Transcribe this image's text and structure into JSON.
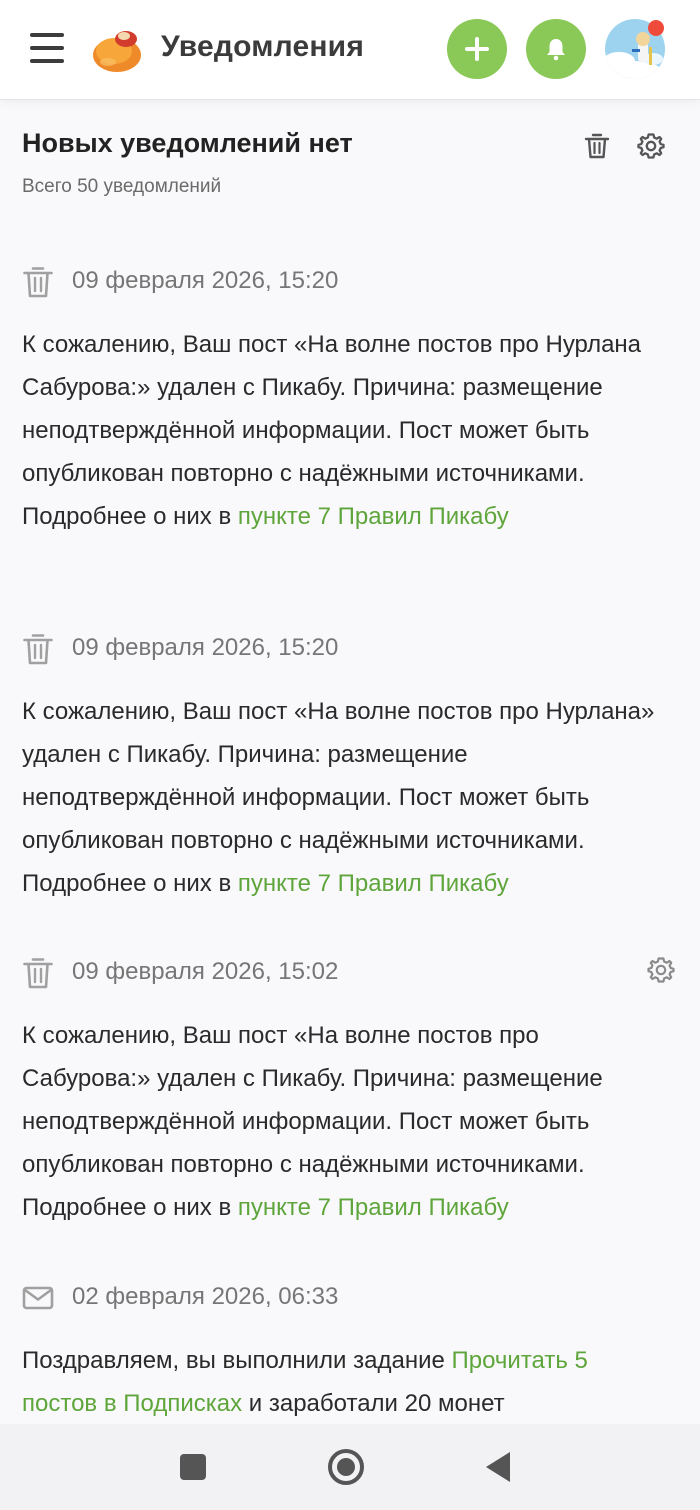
{
  "header": {
    "title": "Уведомления",
    "accent": "#8ac858"
  },
  "summary": {
    "title": "Новых уведомлений нет",
    "subtitle": "Всего 50 уведомлений"
  },
  "notifications": [
    {
      "icon": "trash-icon",
      "date": "09 февраля 2026, 15:20",
      "text": "К сожалению, Ваш пост «На волне постов про Нурлана Сабурова:» удален с Пикабу. Причина: размещение неподтверждённой информации. Пост может быть опубликован повторно с надёжными источниками. Подробнее о них в ",
      "link": "пункте 7 Правил Пикабу",
      "after": ""
    },
    {
      "icon": "trash-icon",
      "date": "09 февраля 2026, 15:20",
      "text": "К сожалению, Ваш пост «На волне постов про Нурлана» удален с Пикабу. Причина: размещение неподтверждённой информации. Пост может быть опубликован повторно с надёжными источниками. Подробнее о них в ",
      "link": "пункте 7 Правил Пикабу",
      "after": ""
    },
    {
      "icon": "trash-icon",
      "date": "09 февраля 2026, 15:02",
      "text": "К сожалению, Ваш пост «На волне постов про Сабурова:» удален с Пикабу. Причина: размещение неподтверждённой информации. Пост может быть опубликован повторно с надёжными источниками. Подробнее о них в ",
      "link": "пункте 7 Правил Пикабу",
      "after": ""
    },
    {
      "icon": "envelope-icon",
      "date": "02 февраля 2026, 06:33",
      "text": "Поздравляем, вы выполнили задание ",
      "link": "Прочитать 5 постов в Подписках",
      "after": " и заработали 20 монет"
    }
  ],
  "colors": {
    "link": "#5ea53b",
    "button": "#8ac858",
    "date": "#767676"
  }
}
